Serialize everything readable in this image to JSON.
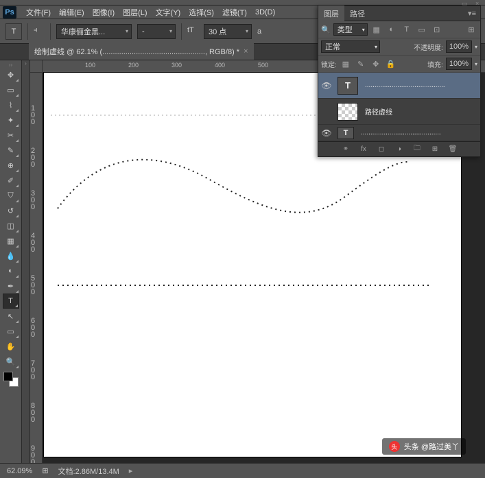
{
  "menubar": {
    "items": [
      "文件(F)",
      "编辑(E)",
      "图像(I)",
      "图层(L)",
      "文字(Y)",
      "选择(S)",
      "滤镜(T)",
      "3D(D)"
    ]
  },
  "options": {
    "tool_letter": "T",
    "orient_icon": "⟷",
    "font_family": "华康俪金黑...",
    "font_style": "-",
    "size_icon": "tT",
    "font_size": "30 点",
    "aa_label": "a"
  },
  "doctab": {
    "title": "绘制虚线 @ 62.1% (................................................., RGB/8) *"
  },
  "ruler": {
    "h": [
      "100",
      "200",
      "300",
      "400",
      "500"
    ],
    "v": [
      "100",
      "200",
      "300",
      "400",
      "500",
      "600",
      "700",
      "800",
      "900"
    ]
  },
  "layers_panel": {
    "tabs": [
      "图层",
      "路径"
    ],
    "kind_label": "类型",
    "blend_mode": "正常",
    "opacity_label": "不透明度:",
    "opacity_value": "100%",
    "lock_label": "锁定:",
    "fill_label": "填充:",
    "fill_value": "100%",
    "layers": [
      {
        "eye": "👁",
        "thumb": "T",
        "name": "..........................................",
        "selected": true,
        "type": "text"
      },
      {
        "eye": "",
        "thumb": "trans",
        "name": "路径虚线",
        "selected": false,
        "type": "trans"
      },
      {
        "eye": "👁",
        "thumb": "T",
        "name": "..........................................",
        "selected": false,
        "type": "text"
      }
    ]
  },
  "status": {
    "zoom": "62.09%",
    "doc": "文档:2.86M/13.4M"
  },
  "watermark": {
    "text": "头条 @路过美丫"
  }
}
